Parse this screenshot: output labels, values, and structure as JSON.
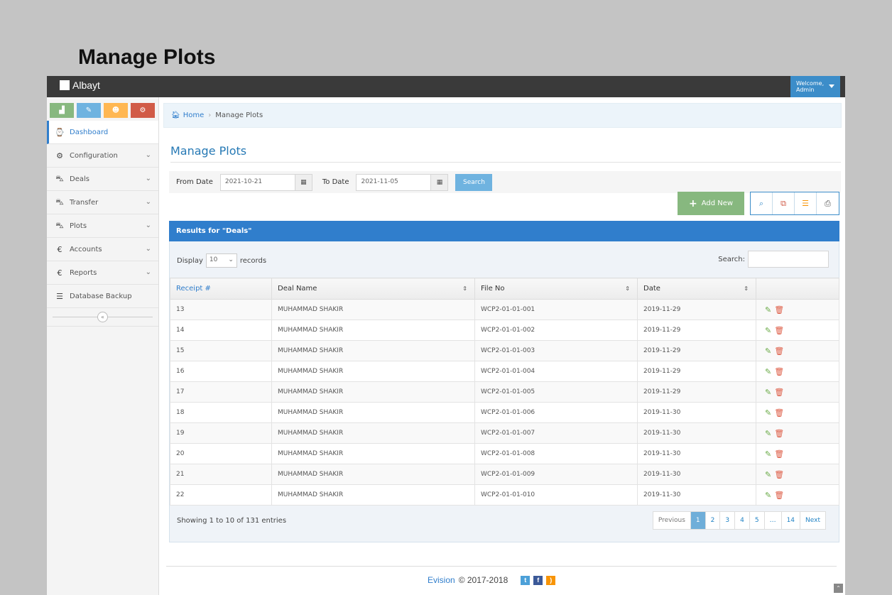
{
  "page_heading": "Manage Plots",
  "app": {
    "brand": "Albayt",
    "user_welcome": "Welcome,",
    "user_name": "Admin"
  },
  "colors": {
    "topbar": "#3a3a3a",
    "accent": "#307ecc",
    "success": "#87b87f",
    "danger": "#dd5a43"
  },
  "sidebar": {
    "shortcuts": [
      {
        "icon": "signal-icon",
        "color": "#87b87f"
      },
      {
        "icon": "pencil-icon",
        "color": "#6fb3e0"
      },
      {
        "icon": "users-icon",
        "color": "#ffb752"
      },
      {
        "icon": "cogs-icon",
        "color": "#d15b47"
      }
    ],
    "items": [
      {
        "label": "Dashboard",
        "icon": "tachometer-icon"
      },
      {
        "label": "Configuration",
        "icon": "cogs-icon"
      },
      {
        "label": "Deals",
        "icon": "cart-icon"
      },
      {
        "label": "Transfer",
        "icon": "cart-icon"
      },
      {
        "label": "Plots",
        "icon": "cart-icon"
      },
      {
        "label": "Accounts",
        "icon": "euro-icon"
      },
      {
        "label": "Reports",
        "icon": "euro-icon"
      },
      {
        "label": "Database Backup",
        "icon": "database-icon"
      }
    ]
  },
  "breadcrumb": {
    "home": "Home",
    "current": "Manage Plots"
  },
  "main": {
    "title": "Manage Plots"
  },
  "filter": {
    "from_label": "From Date",
    "from_value": "2021-10-21",
    "to_label": "To Date",
    "to_value": "2021-11-05",
    "search_label": "Search"
  },
  "toolbar": {
    "add_new": "Add New"
  },
  "results": {
    "title": "Results for \"Deals\""
  },
  "table_controls": {
    "display": "Display",
    "length": "10",
    "records": "records",
    "search": "Search:"
  },
  "table": {
    "columns": [
      "Receipt #",
      "Deal Name",
      "File No",
      "Date"
    ],
    "rows": [
      [
        "13",
        "MUHAMMAD SHAKIR",
        "WCP2-01-01-001",
        "2019-11-29"
      ],
      [
        "14",
        "MUHAMMAD SHAKIR",
        "WCP2-01-01-002",
        "2019-11-29"
      ],
      [
        "15",
        "MUHAMMAD SHAKIR",
        "WCP2-01-01-003",
        "2019-11-29"
      ],
      [
        "16",
        "MUHAMMAD SHAKIR",
        "WCP2-01-01-004",
        "2019-11-29"
      ],
      [
        "17",
        "MUHAMMAD SHAKIR",
        "WCP2-01-01-005",
        "2019-11-29"
      ],
      [
        "18",
        "MUHAMMAD SHAKIR",
        "WCP2-01-01-006",
        "2019-11-30"
      ],
      [
        "19",
        "MUHAMMAD SHAKIR",
        "WCP2-01-01-007",
        "2019-11-30"
      ],
      [
        "20",
        "MUHAMMAD SHAKIR",
        "WCP2-01-01-008",
        "2019-11-30"
      ],
      [
        "21",
        "MUHAMMAD SHAKIR",
        "WCP2-01-01-009",
        "2019-11-30"
      ],
      [
        "22",
        "MUHAMMAD SHAKIR",
        "WCP2-01-01-010",
        "2019-11-30"
      ]
    ]
  },
  "pagination": {
    "info": "Showing 1 to 10 of 131 entries",
    "prev": "Previous",
    "pages": [
      "1",
      "2",
      "3",
      "4",
      "5",
      "…",
      "14"
    ],
    "next": "Next"
  },
  "footer": {
    "brand": "Evision",
    "copyright": "© 2017-2018"
  }
}
